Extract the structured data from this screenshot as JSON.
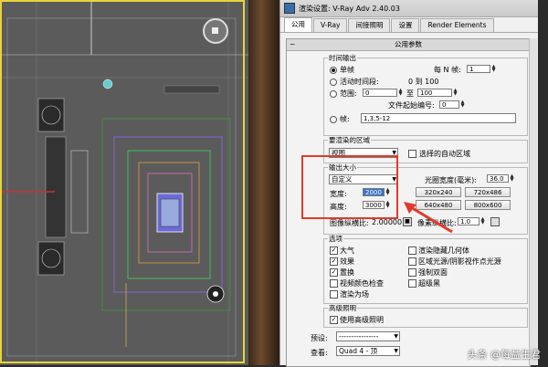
{
  "viewport": {
    "corner_icon": "viewport-nav-icon"
  },
  "dialog": {
    "title": "渲染设置: V-Ray Adv 2.40.03",
    "tabs": [
      "公用",
      "V-Ray",
      "间接照明",
      "设置",
      "Render Elements"
    ],
    "rollout_title": "公用参数",
    "time_output": {
      "title": "时间输出",
      "single": "单帧",
      "every_n_label": "每 N 帧:",
      "every_n_value": "1",
      "active_segment": "活动时间段:",
      "active_range": "0 到 100",
      "range": "范围:",
      "range_from": "0",
      "range_to_label": "至",
      "range_to": "100",
      "file_start_label": "文件起始编号:",
      "file_start": "0",
      "frames": "帧:",
      "frames_value": "1,3,5-12"
    },
    "render_area": {
      "title": "要渲染的区域",
      "view": "视图",
      "auto_region": "选择的自动区域"
    },
    "output_size": {
      "title": "输出大小",
      "preset": "自定义",
      "aperture_label": "光圈宽度(毫米):",
      "aperture_value": "36.0",
      "width_label": "宽度:",
      "width_value": "2000",
      "height_label": "高度:",
      "height_value": "3000",
      "presets": [
        "320x240",
        "720x486",
        "640x480",
        "800x600"
      ],
      "image_aspect_label": "图像纵横比:",
      "image_aspect_value": "2.00000",
      "pixel_aspect_label": "像素纵横比:",
      "pixel_aspect_value": "1.0"
    },
    "options": {
      "title": "选项",
      "items_left": [
        {
          "label": "大气",
          "checked": true
        },
        {
          "label": "效果",
          "checked": true
        },
        {
          "label": "置换",
          "checked": true
        },
        {
          "label": "视频颜色检查",
          "checked": false
        },
        {
          "label": "渲染为场",
          "checked": false
        }
      ],
      "items_right": [
        {
          "label": "渲染隐藏几何体",
          "checked": false
        },
        {
          "label": "区域光源/阴影视作点光源",
          "checked": false
        },
        {
          "label": "强制双面",
          "checked": false
        },
        {
          "label": "超级黑",
          "checked": false
        }
      ]
    },
    "advanced_lighting": {
      "title": "高级照明",
      "use": "使用高级照明",
      "use_checked": true
    },
    "preset_label": "预设:",
    "preset_value": "----------------",
    "view_label": "查看:",
    "view_value": "Quad 4 - 顶"
  },
  "watermark": "头条 @每益生君",
  "colors": {
    "highlight_red": "#e23a2a",
    "viewport_border": "#e8d43a",
    "selection_blue": "#3a74c6"
  }
}
